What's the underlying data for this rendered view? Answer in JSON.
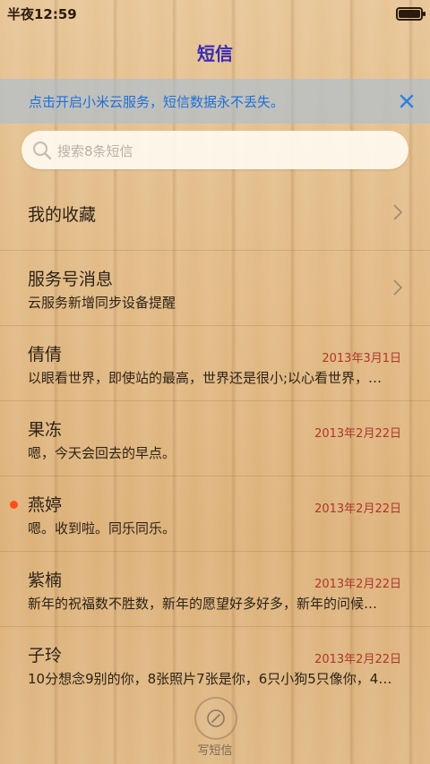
{
  "status_bar": {
    "time": "半夜12:59"
  },
  "header": {
    "title": "短信"
  },
  "notice": {
    "text": "点击开启小米云服务，短信数据永不丢失。"
  },
  "search": {
    "placeholder": "搜索8条短信"
  },
  "list": {
    "favorites": {
      "title": "我的收藏"
    },
    "service": {
      "title": "服务号消息",
      "subtitle": "云服务新增同步设备提醒"
    },
    "messages": [
      {
        "name": "倩倩",
        "date": "2013年3月1日",
        "preview": "以眼看世界，即使站的最高，世界还是很小;以心看世界，…",
        "unread": false
      },
      {
        "name": "果冻",
        "date": "2013年2月22日",
        "preview": "嗯，今天会回去的早点。",
        "unread": false
      },
      {
        "name": "燕婷",
        "date": "2013年2月22日",
        "preview": "嗯。收到啦。同乐同乐。",
        "unread": true
      },
      {
        "name": "紫楠",
        "date": "2013年2月22日",
        "preview": "新年的祝福数不胜数，新年的愿望好多好多，新年的问候…",
        "unread": false
      },
      {
        "name": "子玲",
        "date": "2013年2月22日",
        "preview": "10分想念9别的你，8张照片7张是你，6只小狗5只像你，4…",
        "unread": false
      }
    ]
  },
  "compose": {
    "label": "写短信"
  },
  "colors": {
    "title": "#3a2bb6",
    "notice_text": "#1f6fd6",
    "date": "#b0352a",
    "unread_dot": "#ff4e1a"
  }
}
